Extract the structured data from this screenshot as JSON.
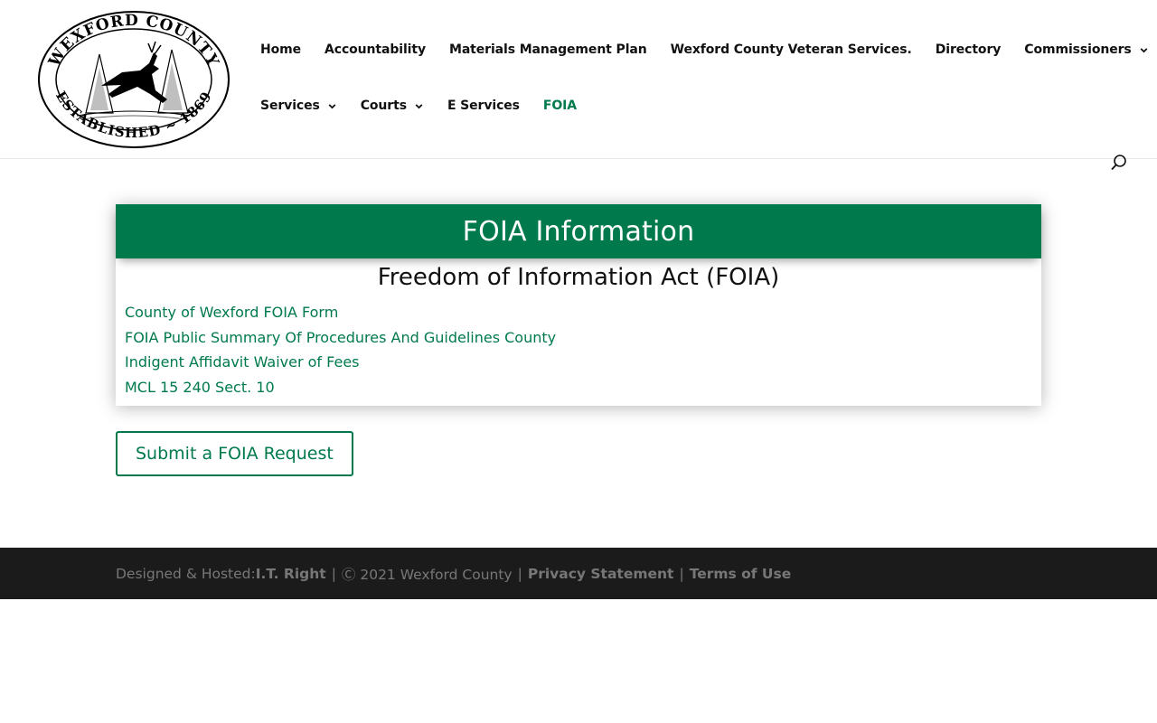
{
  "logo": {
    "top_text": "WEXFORD COUNTY",
    "bottom_text": "ESTABLISHED ~ 1869"
  },
  "nav": {
    "row1": [
      {
        "label": "Home",
        "dropdown": false
      },
      {
        "label": "Accountability",
        "dropdown": false
      },
      {
        "label": "Materials Management Plan",
        "dropdown": false
      },
      {
        "label": "Wexford County Veteran Services.",
        "dropdown": false
      },
      {
        "label": "Directory",
        "dropdown": false
      },
      {
        "label": "Commissioners",
        "dropdown": true
      }
    ],
    "row2": [
      {
        "label": "Services",
        "dropdown": true
      },
      {
        "label": "Courts",
        "dropdown": true
      },
      {
        "label": "E Services",
        "dropdown": false
      },
      {
        "label": "FOIA",
        "dropdown": false,
        "active": true
      }
    ]
  },
  "panel": {
    "title": "FOIA Information",
    "subtitle": "Freedom of Information Act (FOIA)",
    "links": [
      "County of Wexford FOIA Form",
      "FOIA Public Summary Of Procedures And Guidelines County",
      "Indigent Affidavit Waiver of Fees",
      "MCL 15 240 Sect. 10"
    ]
  },
  "submit_button": "Submit a FOIA Request",
  "footer": {
    "prefix": "Designed & Hosted: ",
    "company": "I.T. Right",
    "sep1": "|",
    "copyright": "Ⓒ 2021 Wexford County",
    "sep2": "|",
    "privacy": "Privacy Statement",
    "sep3": "|",
    "terms": "Terms of Use"
  },
  "colors": {
    "accent": "#007a4c",
    "footer_bg": "#1b1b1b",
    "footer_text": "#777777"
  },
  "icons": {
    "search": "search-icon",
    "dropdown": "chevron-down-icon"
  }
}
